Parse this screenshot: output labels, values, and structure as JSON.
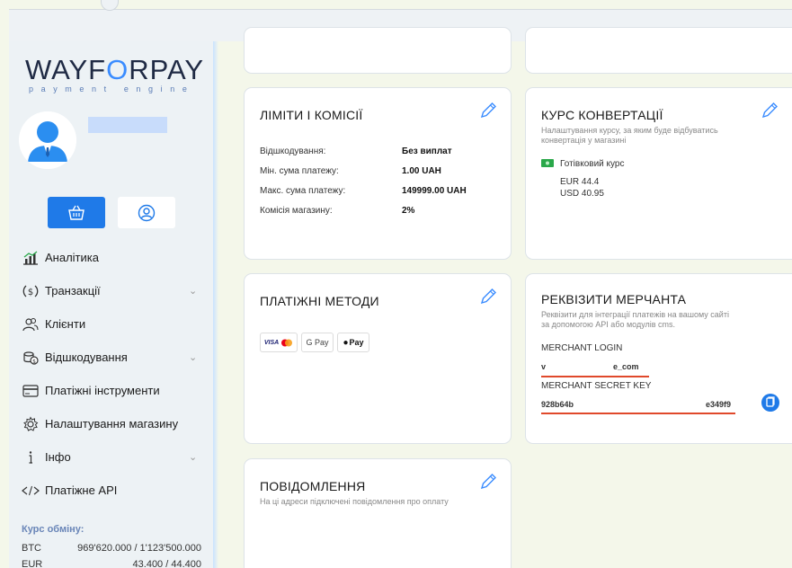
{
  "brand": {
    "logo_pre": "WAYF",
    "logo_o": "O",
    "logo_post": "RPAY",
    "tagline": "payment engine"
  },
  "sidebar": {
    "menu": [
      {
        "label": "Аналітика",
        "icon": "analytics-icon",
        "chevron": false
      },
      {
        "label": "Транзакції",
        "icon": "dollar-circle-icon",
        "chevron": true
      },
      {
        "label": "Клієнти",
        "icon": "users-icon",
        "chevron": false
      },
      {
        "label": "Відшкодування",
        "icon": "refund-coins-icon",
        "chevron": true
      },
      {
        "label": "Платіжні інструменти",
        "icon": "credit-card-icon",
        "chevron": false
      },
      {
        "label": "Налаштування магазину",
        "icon": "gear-icon",
        "chevron": false
      },
      {
        "label": "Інфо",
        "icon": "info-icon",
        "chevron": true
      },
      {
        "label": "Платіжне API",
        "icon": "code-icon",
        "chevron": false
      }
    ],
    "rates_title": "Курс обміну:",
    "rates": [
      {
        "cur": "BTC",
        "val": "969'620.000 / 1'123'500.000"
      },
      {
        "cur": "EUR",
        "val": "43.400 / 44.400"
      }
    ]
  },
  "limits": {
    "title": "ЛІМІТИ І КОМІСІЇ",
    "rows": [
      {
        "k": "Відшкодування:",
        "v": "Без виплат"
      },
      {
        "k": "Мін. сума платежу:",
        "v": "1.00 UAH"
      },
      {
        "k": "Макс. сума платежу:",
        "v": "149999.00 UAH"
      },
      {
        "k": "Комісія магазину:",
        "v": "2%"
      }
    ]
  },
  "conversion": {
    "title": "КУРС КОНВЕРТАЦІЇ",
    "subtitle_line1": "Налаштування курсу, за яким буде відбуватись",
    "subtitle_line2": "конвертація у магазині",
    "cash_label": "Готівковий курс",
    "eur": "EUR 44.4",
    "usd": "USD 40.95"
  },
  "methods": {
    "title": "ПЛАТІЖНІ МЕТОДИ",
    "visa": "VISA",
    "gpay": "G Pay",
    "apay": "Pay"
  },
  "merchant": {
    "title": "РЕКВІЗИТИ МЕРЧАНТА",
    "subtitle_line1": "Реквізити для інтеграції платежів на вашому сайті",
    "subtitle_line2": "за допомогою API або модулів cms.",
    "login_label": "MERCHANT LOGIN",
    "login_start": "v",
    "login_end": "e_com",
    "key_label": "MERCHANT SECRET KEY",
    "key_start": "928b64b",
    "key_end": "e349f9"
  },
  "notifications": {
    "title": "ПОВІДОМЛЕННЯ",
    "subtitle": "На ці адреси підключені повідомлення про оплату"
  },
  "colors": {
    "accent": "#1f7ae8",
    "redline": "#e0492b",
    "pencil": "#3a8cff"
  }
}
